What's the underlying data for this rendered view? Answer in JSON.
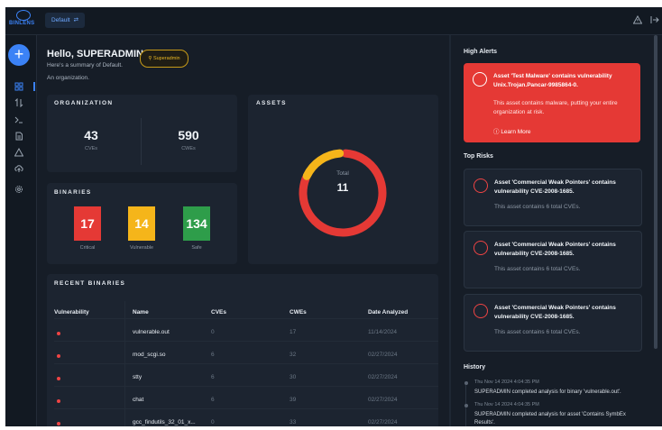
{
  "topbar": {
    "logo_text": "BINLENS",
    "workspace_label": "Default",
    "workspace_icon": "swap-icon",
    "warning_icon": "warning-icon",
    "expand_icon": "expand-icon"
  },
  "sidebar": {
    "add_label": "+",
    "items": [
      "grid-icon",
      "swap-icon",
      "terminal-icon",
      "document-icon",
      "warning-icon",
      "cloud-upload-icon",
      "settings-icon"
    ]
  },
  "header": {
    "greeting": "Hello, SUPERADMIN",
    "subtitle": "Here's a summary of Default.",
    "description": "An organization.",
    "role_badge": "Superadmin"
  },
  "organization": {
    "title": "ORGANIZATION",
    "cves_count": "43",
    "cves_label": "CVEs",
    "cwes_count": "590",
    "cwes_label": "CWEs"
  },
  "assets": {
    "title": "ASSETS",
    "total_label": "Total",
    "total_value": "11",
    "donut_fraction_yellow": 0.18,
    "colors": {
      "red": "#e53935",
      "yellow": "#f5b51a",
      "track": "#2a3441"
    }
  },
  "binaries": {
    "title": "BINARIES",
    "critical": {
      "value": "17",
      "label": "Critical",
      "color": "#e53935"
    },
    "vulnerable": {
      "value": "14",
      "label": "Vulnerable",
      "color": "#f5b51a"
    },
    "safe": {
      "value": "134",
      "label": "Safe",
      "color": "#2e9d4a"
    }
  },
  "recent_binaries": {
    "title": "RECENT BINARIES",
    "columns": [
      "Vulnerability",
      "Name",
      "CVEs",
      "CWEs",
      "Date Analyzed"
    ],
    "rows": [
      {
        "name": "vulnerable.out",
        "cves": "0",
        "cwes": "17",
        "date": "11/14/2024"
      },
      {
        "name": "mod_scgi.so",
        "cves": "6",
        "cwes": "32",
        "date": "02/27/2024"
      },
      {
        "name": "stty",
        "cves": "6",
        "cwes": "30",
        "date": "02/27/2024"
      },
      {
        "name": "chat",
        "cves": "6",
        "cwes": "39",
        "date": "02/27/2024"
      },
      {
        "name": "gcc_findutils_32_01_x...",
        "cves": "0",
        "cwes": "33",
        "date": "02/27/2024"
      }
    ]
  },
  "high_alerts": {
    "title": "High Alerts",
    "alert_title": "Asset 'Test Malware' contains vulnerability Unix.Trojan.Pancar-9985864-0.",
    "alert_body": "This asset contains malware, putting your entire organization at risk.",
    "learn_more": "Learn More"
  },
  "top_risks": {
    "title": "Top Risks",
    "items": [
      {
        "title": "Asset 'Commercial Weak Pointers' contains vulnerability CVE-2008-1685.",
        "desc": "This asset contains 6 total CVEs."
      },
      {
        "title": "Asset 'Commercial Weak Pointers' contains vulnerability CVE-2008-1685.",
        "desc": "This asset contains 6 total CVEs."
      },
      {
        "title": "Asset 'Commercial Weak Pointers' contains vulnerability CVE-2008-1685.",
        "desc": "This asset contains 6 total CVEs."
      }
    ]
  },
  "history": {
    "title": "History",
    "items": [
      {
        "date": "Thu Nov 14 2024 4:04:35 PM",
        "text": "SUPERADMIN completed analysis for binary 'vulnerable.out'."
      },
      {
        "date": "Thu Nov 14 2024 4:04:35 PM",
        "text": "SUPERADMIN completed analysis for asset 'Contains SymbEx Results'."
      }
    ]
  }
}
